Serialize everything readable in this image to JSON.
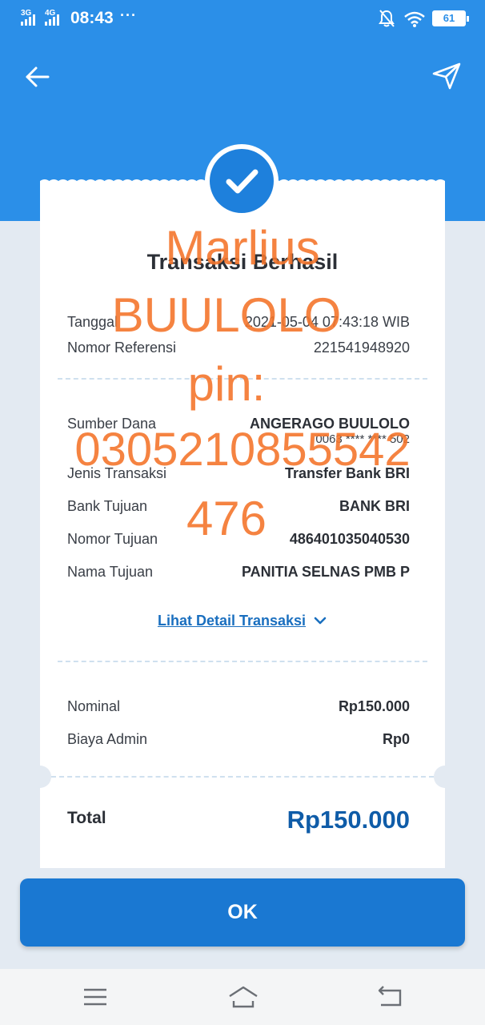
{
  "status_bar": {
    "network_1": "3G",
    "network_2": "4G",
    "time": "08:43",
    "more": "···",
    "battery": "61"
  },
  "header": {
    "back_icon": "arrow-left-icon",
    "share_icon": "send-icon"
  },
  "receipt": {
    "title": "Transaksi Berhasil",
    "section1": [
      {
        "label": "Tanggal",
        "value": "2021-05-04 07:43:18 WIB"
      },
      {
        "label": "Nomor Referensi",
        "value": "221541948920"
      }
    ],
    "section2": [
      {
        "label": "Sumber Dana",
        "value": "ANGERAGO BUULOLO",
        "sub": "0063 **** **** 502"
      },
      {
        "label": "Jenis Transaksi",
        "value": "Transfer Bank BRI"
      },
      {
        "label": "Bank Tujuan",
        "value": "BANK BRI"
      },
      {
        "label": "Nomor Tujuan",
        "value": "486401035040530"
      },
      {
        "label": "Nama Tujuan",
        "value": "PANITIA SELNAS PMB P"
      }
    ],
    "detail_link": "Lihat Detail Transaksi",
    "section3": [
      {
        "label": "Nominal",
        "value": "Rp150.000"
      },
      {
        "label": "Biaya Admin",
        "value": "Rp0"
      }
    ],
    "total_label": "Total",
    "total_value": "Rp150.000"
  },
  "ok_button": "OK",
  "watermark": {
    "line1": "Marlius",
    "line2": "BUULOLO",
    "line3": "pin:",
    "line4": "0305210855542",
    "line5": "476"
  },
  "colors": {
    "header": "#2b8fe8",
    "primary_button": "#1a78d2",
    "total_text": "#0f5ca8",
    "watermark": "#f4762c"
  }
}
